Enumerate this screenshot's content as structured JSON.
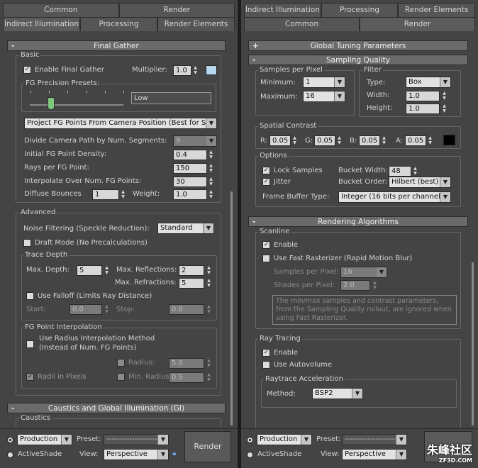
{
  "left": {
    "tabs_row1": [
      "Common",
      "Render"
    ],
    "tabs_row2": [
      "Indirect Illumination",
      "Processing",
      "Render Elements"
    ],
    "rollout_final_gather": "Final Gather",
    "basic": {
      "title": "Basic",
      "enable_final_gather": "Enable Final Gather",
      "multiplier_label": "Multiplier:",
      "multiplier_value": "1.0",
      "presets_title": "FG Precision Presets:",
      "preset_value": "Low",
      "projection": "Project FG Points From Camera Position (Best for Stills)",
      "divide_label": "Divide Camera Path by Num. Segments:",
      "divide_value": "9",
      "initial_density_label": "Initial FG Point Density:",
      "initial_density_value": "0.4",
      "rays_label": "Rays per FG Point:",
      "rays_value": "150",
      "interpolate_label": "Interpolate Over Num. FG Points:",
      "interpolate_value": "30",
      "diffuse_label": "Diffuse Bounces",
      "diffuse_value": "1",
      "weight_label": "Weight:",
      "weight_value": "1.0"
    },
    "advanced": {
      "title": "Advanced",
      "noise_label": "Noise Filtering (Speckle Reduction):",
      "noise_value": "Standard",
      "draft_mode": "Draft Mode (No Precalculations)",
      "trace_depth_title": "Trace Depth",
      "max_depth_label": "Max. Depth:",
      "max_depth_value": "5",
      "max_reflections_label": "Max. Reflections:",
      "max_reflections_value": "2",
      "max_refractions_label": "Max. Refractions:",
      "max_refractions_value": "5",
      "use_falloff": "Use Falloff (Limits Ray Distance)",
      "start_label": "Start:",
      "start_value": "0.0",
      "stop_label": "Stop:",
      "stop_value": "0.0",
      "fg_interp_title": "FG Point Interpolation",
      "use_radius_line1": "Use Radius Interpolation Method",
      "use_radius_line2": "(Instead of Num. FG Points)",
      "radius_label": "Radius:",
      "radius_value": "5.0",
      "radii_pixels": "Radii in Pixels",
      "min_radius_label": "Min. Radius:",
      "min_radius_value": "0.5"
    },
    "rollout_caustics": "Caustics and Global Illumination (GI)",
    "caustics_title": "Caustics",
    "bottom": {
      "production": "Production",
      "activeshade": "ActiveShade",
      "preset_label": "Preset:",
      "preset_value": "--------------------",
      "view_label": "View:",
      "view_value": "Perspective",
      "render_button": "Render"
    }
  },
  "right": {
    "tabs_row1": [
      "Indirect Illumination",
      "Processing",
      "Render Elements"
    ],
    "tabs_row2": [
      "Common",
      "Render"
    ],
    "rollout_global_tuning": "Global Tuning Parameters",
    "rollout_sampling": "Sampling Quality",
    "samples_title": "Samples per Pixel",
    "minimum_label": "Minimum:",
    "minimum_value": "1",
    "maximum_label": "Maximum:",
    "maximum_value": "16",
    "filter_title": "Filter",
    "type_label": "Type:",
    "type_value": "Box",
    "width_label": "Width:",
    "width_value": "1.0",
    "height_label": "Height:",
    "height_value": "1.0",
    "contrast_title": "Spatial Contrast",
    "r_label": "R:",
    "r_value": "0.05",
    "g_label": "G:",
    "g_value": "0.05",
    "b_label": "B:",
    "b_value": "0.05",
    "a_label": "A:",
    "a_value": "0.05",
    "options_title": "Options",
    "lock_samples": "Lock Samples",
    "jitter": "Jitter",
    "bucket_width_label": "Bucket Width:",
    "bucket_width_value": "48",
    "bucket_order_label": "Bucket Order:",
    "bucket_order_value": "Hilbert (best)",
    "frame_buffer_label": "Frame Buffer Type:",
    "frame_buffer_value": "Integer (16 bits per channel)",
    "rollout_rendering": "Rendering Algorithms",
    "scanline_title": "Scanline",
    "scanline_enable": "Enable",
    "fast_rasterizer": "Use Fast Rasterizer (Rapid Motion Blur)",
    "samples_pp_label": "Samples per Pixel:",
    "samples_pp_value": "16",
    "shades_pp_label": "Shades per Pixel:",
    "shades_pp_value": "2.0",
    "note": "The min/max samples and contrast parameters, from the Sampling Quality rollout, are ignored when using Fast Rasterizer.",
    "raytracing_title": "Ray Tracing",
    "raytracing_enable": "Enable",
    "autovolume": "Use Autovolume",
    "accel_title": "Raytrace Acceleration",
    "method_label": "Method:",
    "method_value": "BSP2",
    "bottom": {
      "production": "Production",
      "activeshade": "ActiveShade",
      "preset_label": "Preset:",
      "preset_value": "--------------------",
      "view_label": "View:",
      "view_value": "Perspective"
    }
  },
  "watermark": {
    "main": "朱峰社区",
    "sub": "ZF3D.COM"
  },
  "colors": {
    "panel": "#444444",
    "rollout": "#6a6a6a",
    "swatch_light": "#b8d8f0",
    "swatch_dark": "#000000"
  }
}
